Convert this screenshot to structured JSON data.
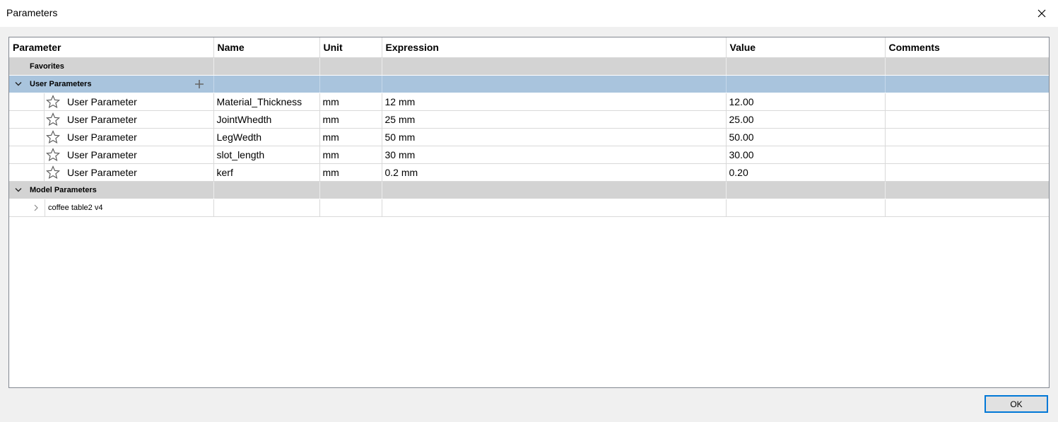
{
  "window": {
    "title": "Parameters"
  },
  "table": {
    "headers": [
      "Parameter",
      "Name",
      "Unit",
      "Expression",
      "Value",
      "Comments"
    ],
    "favorites_label": "Favorites",
    "user_group_label": "User Parameters",
    "user_rows": [
      {
        "type": "User Parameter",
        "name": "Material_Thickness",
        "unit": "mm",
        "expression": "12 mm",
        "value": "12.00",
        "comment": ""
      },
      {
        "type": "User Parameter",
        "name": "JointWhedth",
        "unit": "mm",
        "expression": "25 mm",
        "value": "25.00",
        "comment": ""
      },
      {
        "type": "User Parameter",
        "name": "LegWedth",
        "unit": "mm",
        "expression": "50 mm",
        "value": "50.00",
        "comment": ""
      },
      {
        "type": "User Parameter",
        "name": "slot_length",
        "unit": "mm",
        "expression": "30 mm",
        "value": "30.00",
        "comment": ""
      },
      {
        "type": "User Parameter",
        "name": "kerf",
        "unit": "mm",
        "expression": "0.2 mm",
        "value": "0.20",
        "comment": ""
      }
    ],
    "model_group_label": "Model Parameters",
    "model_items": [
      {
        "label": "coffee table2 v4"
      }
    ]
  },
  "footer": {
    "ok_label": "OK"
  },
  "icons": {
    "close": "close-icon",
    "chevron_down": "chevron-down-icon",
    "chevron_right": "chevron-right-icon",
    "star": "star-icon",
    "plus": "plus-icon"
  },
  "colors": {
    "selected_row": "#a9c4dd",
    "group_row": "#d3d3d3",
    "accent": "#0078d7"
  }
}
